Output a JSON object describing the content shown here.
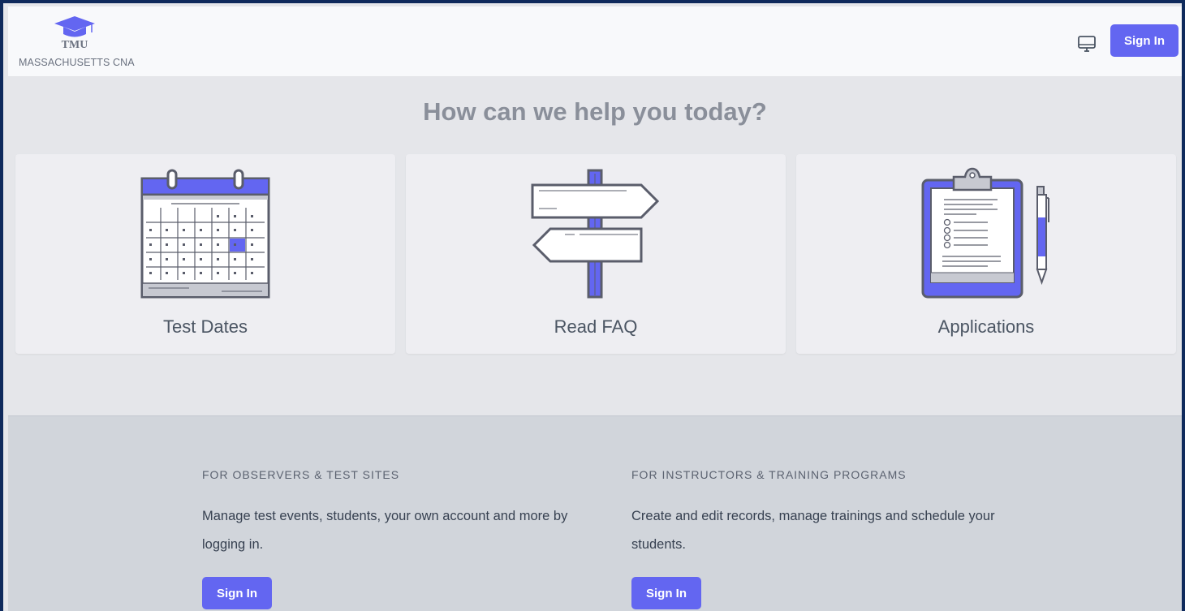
{
  "header": {
    "logo_tmu": "TMU",
    "logo_subtitle": "MASSACHUSETTS CNA",
    "logo_icon": "graduation-cap-icon",
    "monitor_icon": "monitor-icon",
    "signin_label": "Sign In"
  },
  "hero": {
    "title": "How can we help you today?"
  },
  "cards": [
    {
      "label": "Test Dates",
      "icon": "calendar-icon"
    },
    {
      "label": "Read FAQ",
      "icon": "signpost-icon"
    },
    {
      "label": "Applications",
      "icon": "clipboard-icon"
    }
  ],
  "footer": {
    "observers": {
      "heading": "FOR OBSERVERS & TEST SITES",
      "description": "Manage test events, students, your own account and more by logging in.",
      "signin_label": "Sign In"
    },
    "instructors": {
      "heading": "FOR INSTRUCTORS & TRAINING PROGRAMS",
      "description": "Create and edit records, manage trainings and schedule your students.",
      "signin_label": "Sign In"
    }
  },
  "colors": {
    "accent": "#6366f1",
    "icon_stroke": "#5a5d6b",
    "background": "#e5e6ea",
    "footer": "#d1d5db",
    "border": "#0f2a5c"
  }
}
